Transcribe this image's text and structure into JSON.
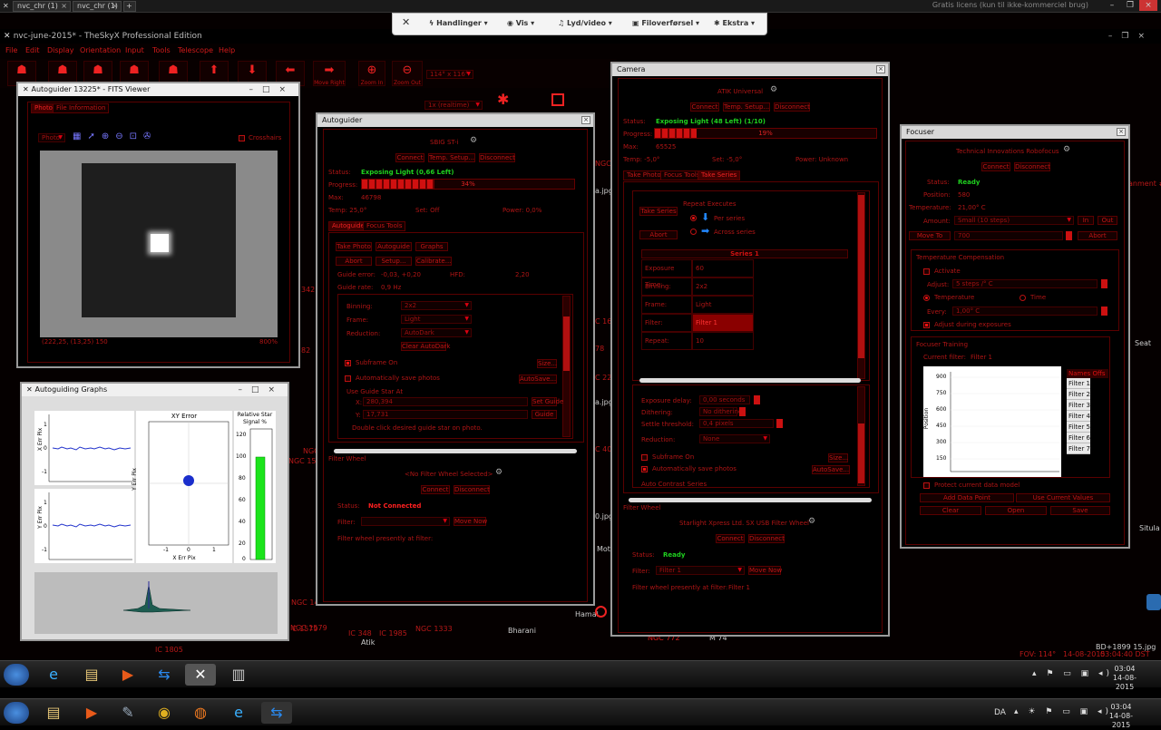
{
  "browser_tabs": [
    "nvc_chr (1)",
    "nvc_chr (1)"
  ],
  "licence_text": "Gratis licens (kun til ikke-kommerciel brug)",
  "app_title": "nvc-june-2015* - TheSkyX Professional Edition",
  "menu": [
    "File",
    "Edit",
    "Display",
    "Orientation",
    "Input",
    "Tools",
    "Telescope",
    "Help"
  ],
  "toolbar": {
    "move_right": "Move Right",
    "zoom_in": "Zoom In",
    "zoom_out": "Zoom Out",
    "fov": "114° x 116°",
    "mode": "1x (realtime)"
  },
  "rdbar": {
    "close": "✕",
    "actions": "Handlinger",
    "view": "Vis",
    "audio": "Lyd/video",
    "file": "Filoverførsel",
    "extra": "Ekstra"
  },
  "sky_labels": [
    "NGC 1528",
    "NGC",
    "NGC 1499",
    "NGC 1579",
    "NGC 1333",
    "IC 348",
    "IC 1985",
    "Atik",
    "Bharani",
    "Hamal",
    "NGC 772",
    "Seat",
    "Situla",
    "FOV: 114°",
    "14-08-2015",
    "03:04:40 DST",
    "BD+1899 15.jpg",
    "a.jpg",
    "a.jpg",
    "0.jpg",
    "Mot",
    "342",
    "82",
    "NGC",
    "C 16",
    "78",
    "C 22",
    "C 40",
    "C.1579",
    "IC 1805",
    "NGC 772",
    "M 74",
    "anment #"
  ],
  "fits": {
    "title": "Autoguider 13225* - FITS Viewer",
    "tab_photo": "Photo",
    "tab_info": "File Information",
    "mode": "Photo",
    "crosshairs": "Crosshairs",
    "status": "(222,25, (13,25) 150",
    "zoom": "800%"
  },
  "graphs": {
    "title": "Autoguiding Graphs",
    "x_label": "X Err Pix",
    "y_label": "Y Err Pix",
    "xy_title": "XY Error",
    "xy_xlabel": "X Err Pix",
    "xy_ylabel": "Y Err Pix",
    "signal_title": "Relative Star Signal %",
    "ticks_small": [
      "1",
      "0",
      "-1"
    ],
    "xy_ticks": [
      "-1",
      "0",
      "1"
    ],
    "sig_ticks": [
      "120",
      "100",
      "80",
      "60",
      "40",
      "20",
      "0"
    ]
  },
  "autoguider": {
    "title": "Autoguider",
    "camera": "SBIG ST-i",
    "connect": "Connect",
    "temp_setup": "Temp. Setup...",
    "disconnect": "Disconnect",
    "status_label": "Status:",
    "status": "Exposing Light (0,66 Left)",
    "progress_label": "Progress:",
    "progress_text": "34%",
    "progress": 0.34,
    "max_label": "Max:",
    "max": "46798",
    "temp": "Temp: 25,0°",
    "setpoint": "Set: Off",
    "power": "Power: 0,0%",
    "tab_autoguide": "Autoguide",
    "tab_focus": "Focus Tools",
    "take_photo": "Take Photo",
    "autoguide": "Autoguide",
    "graphs": "Graphs",
    "abort": "Abort",
    "setup": "Setup...",
    "calibrate": "Calibrate...",
    "guide_error": "Guide error:",
    "guide_error_val": "-0,03, +0,20",
    "hfd": "HFD:",
    "hfd_val": "2,20",
    "guide_rate": "Guide rate:",
    "guide_rate_val": "0,9 Hz",
    "binning_label": "Binning:",
    "binning": "2x2",
    "frame_label": "Frame:",
    "frame": "Light",
    "reduction_label": "Reduction:",
    "reduction": "AutoDark",
    "clear_autodark": "Clear AutoDark",
    "subframe": "Subframe On",
    "size": "Size...",
    "autosave": "Automatically save photos",
    "autosave_btn": "AutoSave...",
    "use_guide_star": "Use Guide Star At",
    "x_label": "X:",
    "x_val": "280,394",
    "y_label": "Y:",
    "y_val": "17,731",
    "set_guide": "Set Guide",
    "guide": "Guide",
    "double_click": "Double click desired guide star on photo.",
    "move_guide_box": "Move Guide Box",
    "filter_wheel": "Filter Wheel",
    "fw_device": "<No Filter Wheel Selected>",
    "fw_connect": "Connect",
    "fw_disconnect": "Disconnect",
    "fw_status_label": "Status:",
    "fw_status": "Not Connected",
    "fw_filter_label": "Filter:",
    "fw_movenow": "Move Now",
    "fw_presently": "Filter wheel presently at filter:"
  },
  "camera": {
    "title": "Camera",
    "device": "ATIK Universal",
    "connect": "Connect",
    "temp_setup": "Temp. Setup...",
    "disconnect": "Disconnect",
    "status_label": "Status:",
    "status": "Exposing Light (48 Left) (1/10)",
    "progress_label": "Progress:",
    "progress_text": "19%",
    "progress": 0.19,
    "max_label": "Max:",
    "max": "65525",
    "temp": "Temp: -5,0°",
    "setpoint": "Set: -5,0°",
    "power": "Power: Unknown",
    "tab_take": "Take Photo",
    "tab_focus": "Focus Tools",
    "tab_series": "Take Series",
    "take_series": "Take Series",
    "abort": "Abort",
    "repeat_label": "Repeat Executes",
    "per_series": "Per series",
    "across_series": "Across series",
    "series_title": "Series 1",
    "rows": [
      {
        "k": "Exposure Time:",
        "v": "60"
      },
      {
        "k": "Binning:",
        "v": "2x2"
      },
      {
        "k": "Frame:",
        "v": "Light"
      },
      {
        "k": "Filter:",
        "v": "Filter 1"
      },
      {
        "k": "Repeat:",
        "v": "10"
      }
    ],
    "exposure_delay_label": "Exposure delay:",
    "exposure_delay": "0,00 seconds",
    "dithering_label": "Dithering:",
    "dithering": "No dithering",
    "settle_label": "Settle threshold:",
    "settle": "0,4 pixels",
    "reduction_label": "Reduction:",
    "reduction": "None",
    "subframe": "Subframe On",
    "size": "Size...",
    "autosave": "Automatically save photos",
    "autosave_btn": "AutoSave...",
    "autocontrast": "Auto Contrast Series",
    "filter_wheel": "Filter Wheel",
    "fw_device": "Starlight Xpress Ltd. SX USB Filter Wheel",
    "fw_connect": "Connect",
    "fw_disconnect": "Disconnect",
    "fw_status_label": "Status:",
    "fw_status": "Ready",
    "fw_filter_label": "Filter:",
    "fw_filter": "Filter 1",
    "fw_movenow": "Move Now",
    "fw_presently": "Filter wheel presently at filter:",
    "fw_presently_val": "Filter 1"
  },
  "focuser": {
    "title": "Focuser",
    "device": "Technical Innovations Robofocus",
    "connect": "Connect",
    "disconnect": "Disconnect",
    "status_label": "Status:",
    "status": "Ready",
    "position_label": "Position:",
    "position": "580",
    "temperature_label": "Temperature:",
    "temperature": "21,00° C",
    "amount_label": "Amount:",
    "amount": "Small (10 steps)",
    "in": "In",
    "out": "Out",
    "move_to": "Move To",
    "move_to_val": "700",
    "abort": "Abort",
    "temp_comp": "Temperature Compensation",
    "activate": "Activate",
    "adjust_label": "Adjust:",
    "adjust": "5 steps /° C",
    "opt_temperature": "Temperature",
    "opt_time": "Time",
    "every_label": "Every:",
    "every": "1,00° C",
    "adjust_during": "Adjust during exposures",
    "training": "Focuser Training",
    "current_filter_label": "Current filter:",
    "current_filter": "Filter 1",
    "y_label": "Position",
    "y_ticks": [
      "900",
      "750",
      "600",
      "450",
      "300",
      "150"
    ],
    "names_offsets": "Names Offs",
    "filters": [
      "Filter 1",
      "Filter 2",
      "Filter 3",
      "Filter 4",
      "Filter 5",
      "Filter 6",
      "Filter 7"
    ],
    "protect": "Protect current data model",
    "add_point": "Add Data Point",
    "use_current": "Use Current Values",
    "clear": "Clear",
    "open": "Open",
    "save": "Save"
  },
  "taskbar": {
    "time": "03:04",
    "date": "14-08-2015",
    "lang": "DA"
  }
}
